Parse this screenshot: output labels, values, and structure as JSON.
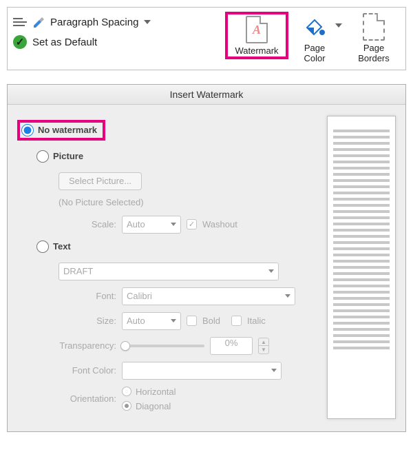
{
  "ribbon": {
    "paragraph_spacing": "Paragraph Spacing",
    "set_as_default": "Set as Default",
    "watermark": "Watermark",
    "page_color": "Page Color",
    "page_borders": "Page Borders"
  },
  "dialog": {
    "title": "Insert Watermark",
    "options": {
      "no_watermark": "No watermark",
      "picture": "Picture",
      "text": "Text"
    },
    "picture": {
      "select_btn": "Select Picture...",
      "none_selected": "(No Picture Selected)",
      "scale_label": "Scale:",
      "scale_value": "Auto",
      "washout": "Washout"
    },
    "text": {
      "preset_value": "DRAFT",
      "font_label": "Font:",
      "font_value": "Calibri",
      "size_label": "Size:",
      "size_value": "Auto",
      "bold": "Bold",
      "italic": "Italic",
      "transparency_label": "Transparency:",
      "transparency_value": "0%",
      "font_color_label": "Font Color:",
      "orientation_label": "Orientation:",
      "orientation_horizontal": "Horizontal",
      "orientation_diagonal": "Diagonal"
    }
  }
}
